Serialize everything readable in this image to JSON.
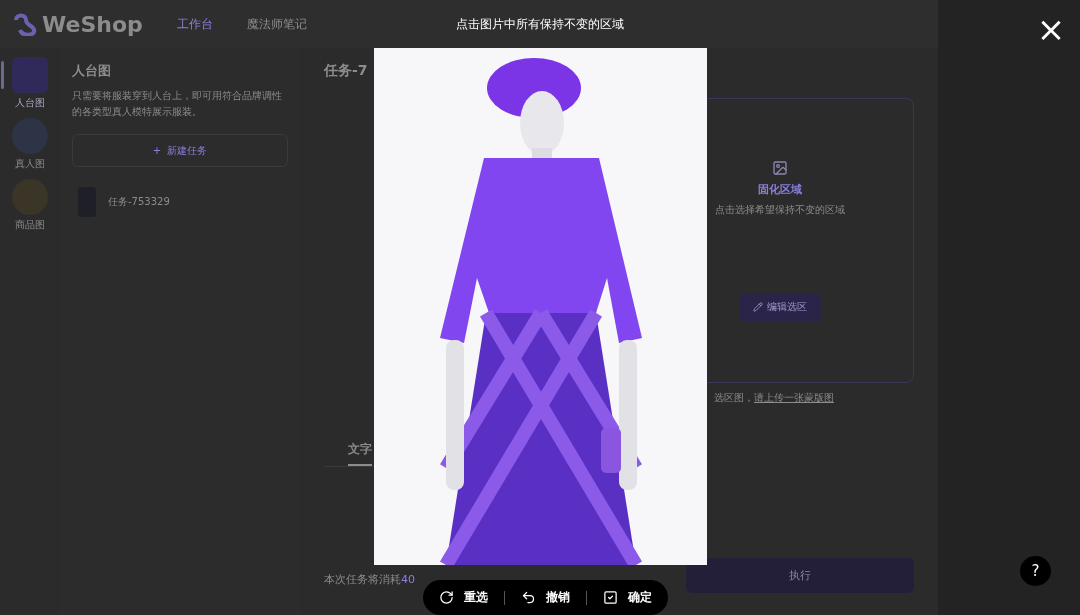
{
  "header": {
    "logo": "WeShop",
    "nav": [
      {
        "label": "工作台",
        "selected": true
      },
      {
        "label": "魔法师笔记",
        "selected": false
      }
    ]
  },
  "sidebar": {
    "items": [
      {
        "label": "人台图",
        "selected": true
      },
      {
        "label": "真人图",
        "selected": false
      },
      {
        "label": "商品图",
        "selected": false
      }
    ]
  },
  "panel": {
    "title": "人台图",
    "description": "只需要将服装穿到人台上，即可用符合品牌调性的各类型真人模特展示服装。",
    "new_task": {
      "icon": "+",
      "label": "新建任务"
    },
    "tasks": [
      {
        "name": "任务-753329"
      }
    ]
  },
  "main": {
    "title": "任务-7",
    "region_card": {
      "title": "固化区域",
      "hint": "点击选择希望保持不变的区域",
      "button": "编辑选区"
    },
    "upload_note": {
      "text": "选区图，",
      "link": "请上传一张蒙版图"
    },
    "tabs": [
      {
        "label": "文字",
        "selected": true
      }
    ],
    "cost_note": {
      "text": "本次任务将消耗",
      "amount": "40"
    },
    "run_button": "执行"
  },
  "modal": {
    "title": "点击图片中所有保持不变的区域",
    "close": "×",
    "toolbar": [
      {
        "kind": "redo",
        "label": "重选"
      },
      {
        "kind": "undo",
        "label": "撤销"
      },
      {
        "kind": "confirm",
        "label": "确定"
      }
    ]
  },
  "help": "?"
}
